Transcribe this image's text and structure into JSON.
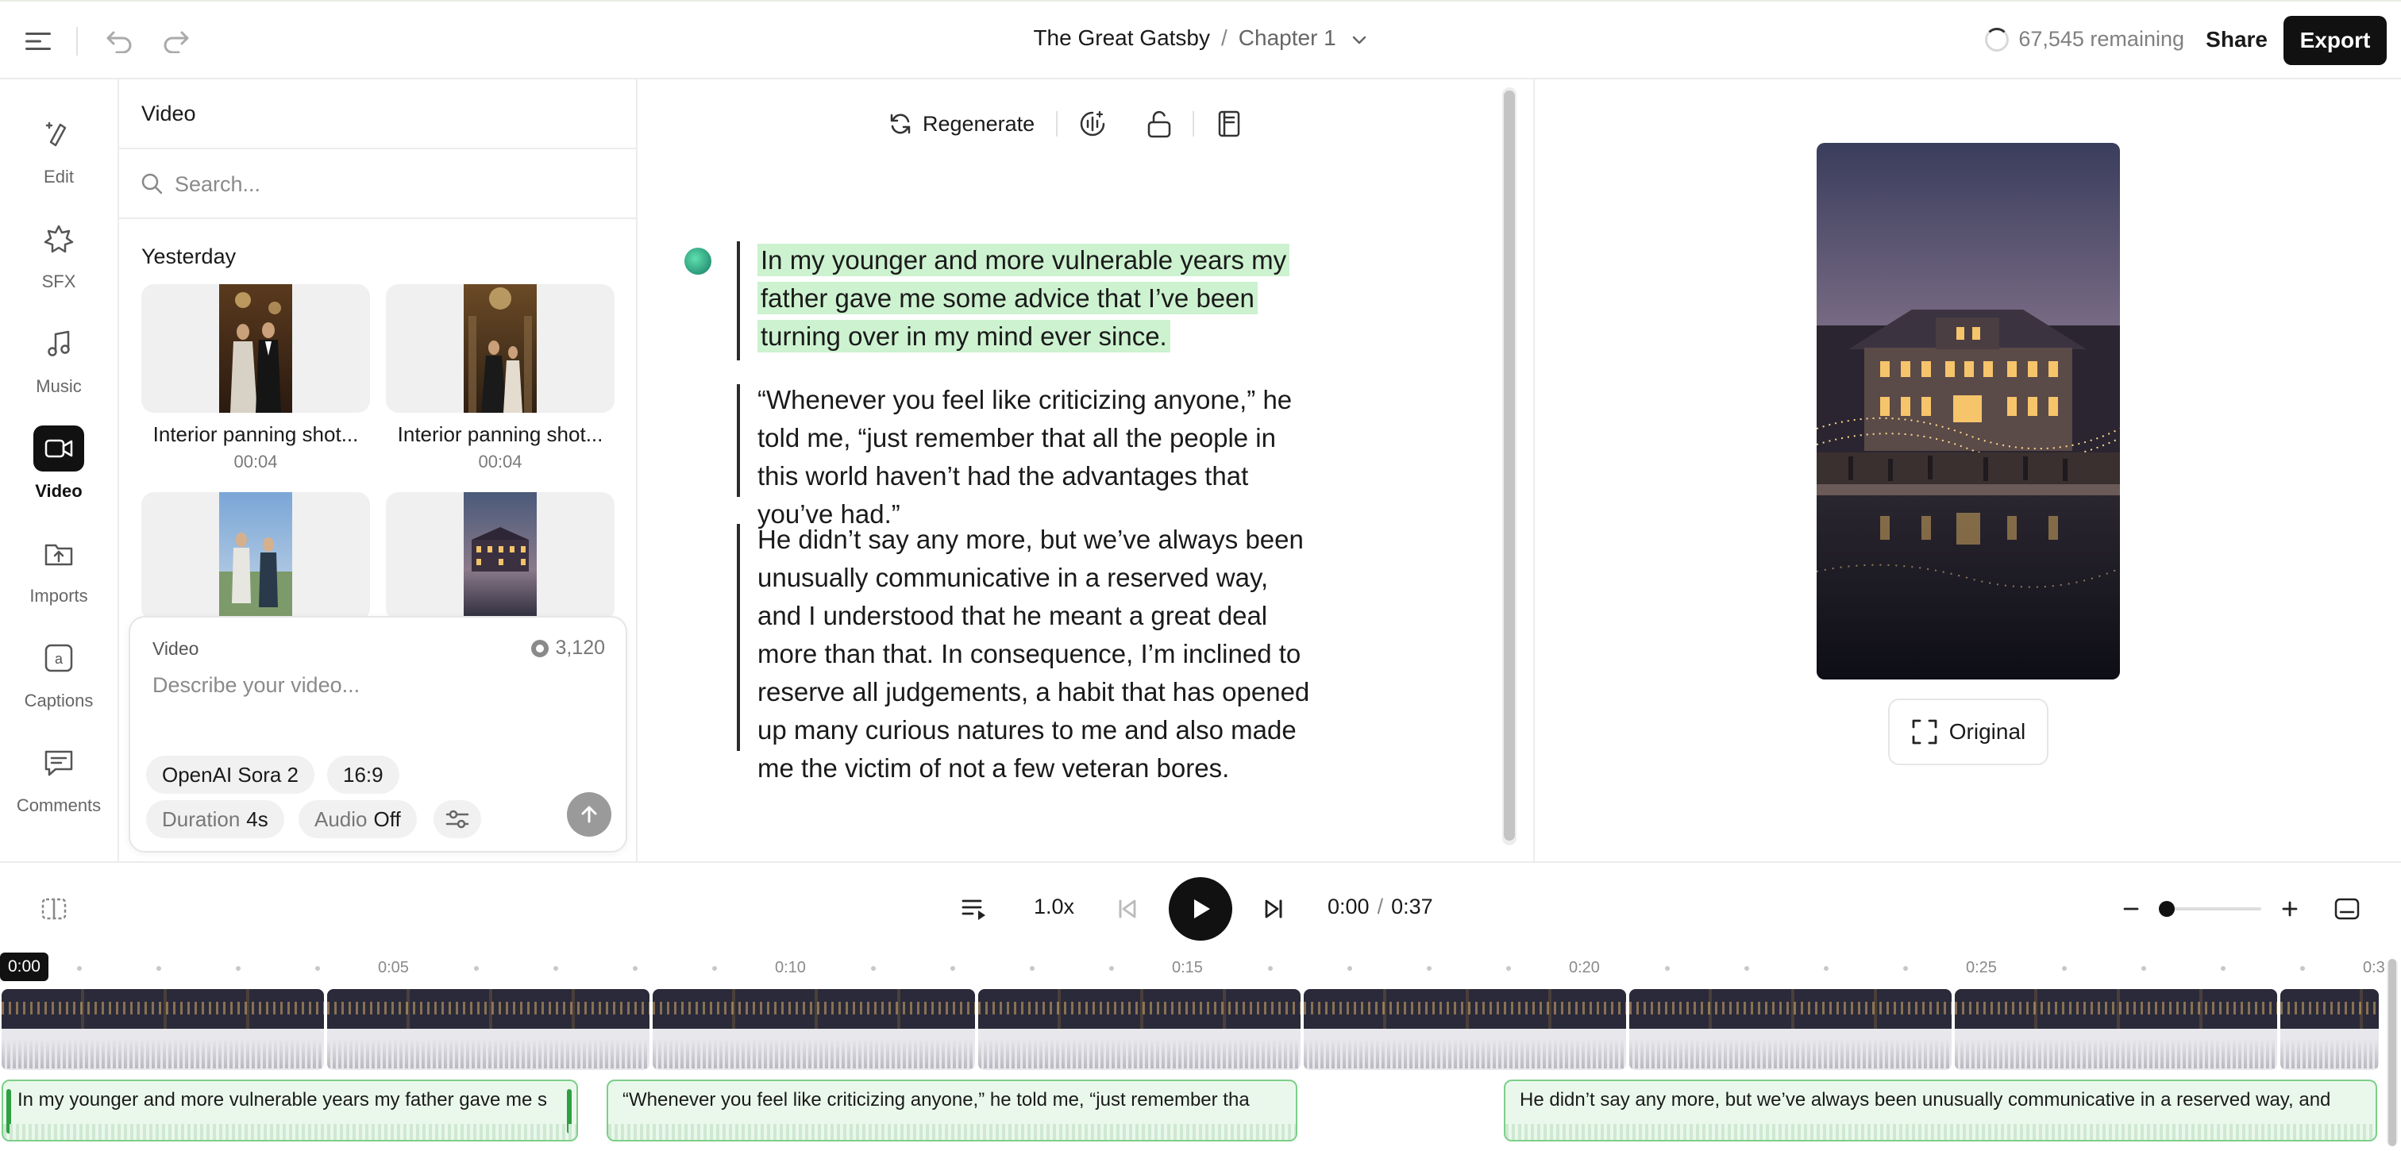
{
  "header": {
    "project_title": "The Great Gatsby",
    "separator": "/",
    "chapter": "Chapter 1",
    "remaining": "67,545 remaining",
    "share_label": "Share",
    "export_label": "Export",
    "icons": [
      "sidebar-toggle-icon",
      "undo-icon",
      "redo-icon",
      "chevron-down-icon"
    ]
  },
  "rail": {
    "items": [
      {
        "label": "Edit",
        "icon": "edit-icon"
      },
      {
        "label": "SFX",
        "icon": "sfx-icon"
      },
      {
        "label": "Music",
        "icon": "music-icon"
      },
      {
        "label": "Video",
        "icon": "video-icon",
        "active": true
      },
      {
        "label": "Imports",
        "icon": "imports-icon"
      },
      {
        "label": "Captions",
        "icon": "captions-icon"
      },
      {
        "label": "Comments",
        "icon": "comments-icon"
      }
    ]
  },
  "video_panel": {
    "title": "Video",
    "search_placeholder": "Search...",
    "section": "Yesterday",
    "items": [
      {
        "title": "Interior panning shot...",
        "duration": "00:04"
      },
      {
        "title": "Interior panning shot...",
        "duration": "00:04"
      },
      {
        "title": "",
        "duration": ""
      },
      {
        "title": "",
        "duration": ""
      }
    ],
    "composer": {
      "label": "Video",
      "credits": "3,120",
      "placeholder": "Describe your video...",
      "model": "OpenAI Sora 2",
      "aspect": "16:9",
      "duration_label": "Duration",
      "duration_value": "4s",
      "audio_label": "Audio",
      "audio_value": "Off"
    }
  },
  "editor": {
    "regenerate_label": "Regenerate",
    "paragraphs": [
      {
        "text": "In my younger and more vulnerable years my father gave me some advice that I’ve been turning over in my mind ever since.",
        "highlighted": true
      },
      {
        "text": "“Whenever you feel like criticizing anyone,” he told me, “just remember that all the people in this world haven’t had the advantages that you’ve had.”",
        "highlighted": false
      },
      {
        "text": "He didn’t say any more, but we’ve always been unusually communicative in a reserved way, and I understood that he meant a great deal more than that. In consequence, I’m inclined to reserve all judgements, a habit that has opened up many curious natures to me and also made me the victim of not a few veteran bores.",
        "highlighted": false
      }
    ]
  },
  "preview": {
    "original_label": "Original"
  },
  "playback": {
    "speed": "1.0x",
    "current_time": "0:00",
    "time_separator": "/",
    "total_time": "0:37",
    "zoom_level": 0.05
  },
  "timeline": {
    "playhead": "0:00",
    "ticks": [
      "0:05",
      "0:10",
      "0:15",
      "0:20",
      "0:25",
      "0:3"
    ],
    "captions": [
      "In my younger and more vulnerable years my father gave me s",
      "“Whenever you feel like criticizing anyone,” he told me, “just remember tha",
      "He didn’t say any more, but we’ve always been unusually communicative in a reserved way, and"
    ]
  },
  "colors": {
    "accent_dark": "#111111",
    "highlight": "#cdf2d0",
    "caption_border": "#7ccf88"
  }
}
